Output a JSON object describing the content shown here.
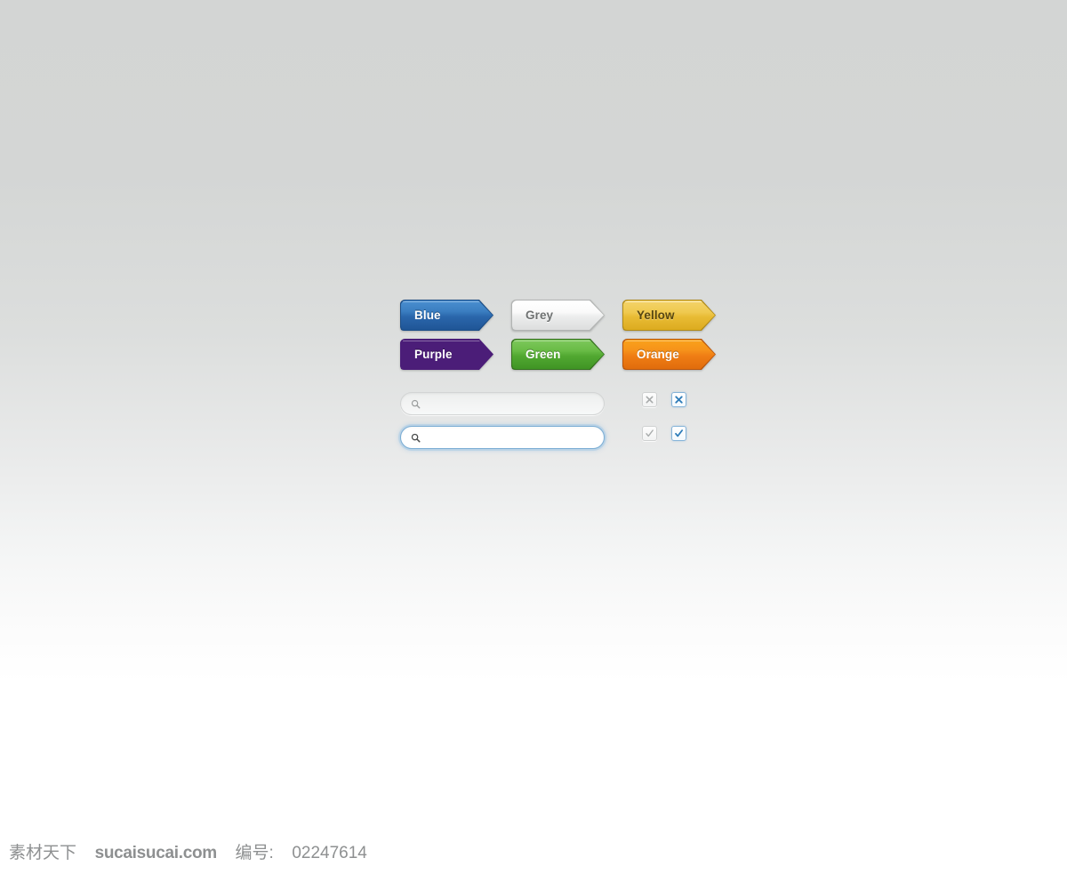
{
  "theme": {
    "background_top": "#d3d5d4",
    "background_bottom": "#ffffff"
  },
  "buttons": [
    {
      "label": "Blue",
      "variant": "v-blue",
      "name": "button-blue",
      "color": "#2a66ab"
    },
    {
      "label": "Grey",
      "variant": "v-grey",
      "name": "button-grey",
      "color": "#eceded"
    },
    {
      "label": "Yellow",
      "variant": "v-yellow",
      "name": "button-yellow",
      "color": "#e8bb34"
    },
    {
      "label": "Purple",
      "variant": "v-purple",
      "name": "button-purple",
      "color": "#7630a8"
    },
    {
      "label": "Green",
      "variant": "v-green",
      "name": "button-green",
      "color": "#51a831"
    },
    {
      "label": "Orange",
      "variant": "v-orange",
      "name": "button-orange",
      "color": "#ef7d14"
    }
  ],
  "search_fields": [
    {
      "state": "idle",
      "value": "",
      "placeholder": "",
      "icon": "search-icon"
    },
    {
      "state": "focused",
      "value": "",
      "placeholder": "",
      "icon": "search-icon"
    }
  ],
  "checkboxes": [
    {
      "mark": "cross",
      "style": "grey",
      "icon": "cross-icon",
      "checked": true
    },
    {
      "mark": "cross",
      "style": "blue",
      "icon": "cross-icon",
      "checked": true
    },
    {
      "mark": "check",
      "style": "grey",
      "icon": "check-icon",
      "checked": true
    },
    {
      "mark": "check",
      "style": "blue",
      "icon": "check-icon",
      "checked": true
    }
  ],
  "watermark": {
    "brand": "素材天下",
    "site": "sucaisucai.com",
    "id_label": "编号:",
    "id_value": "02247614"
  }
}
